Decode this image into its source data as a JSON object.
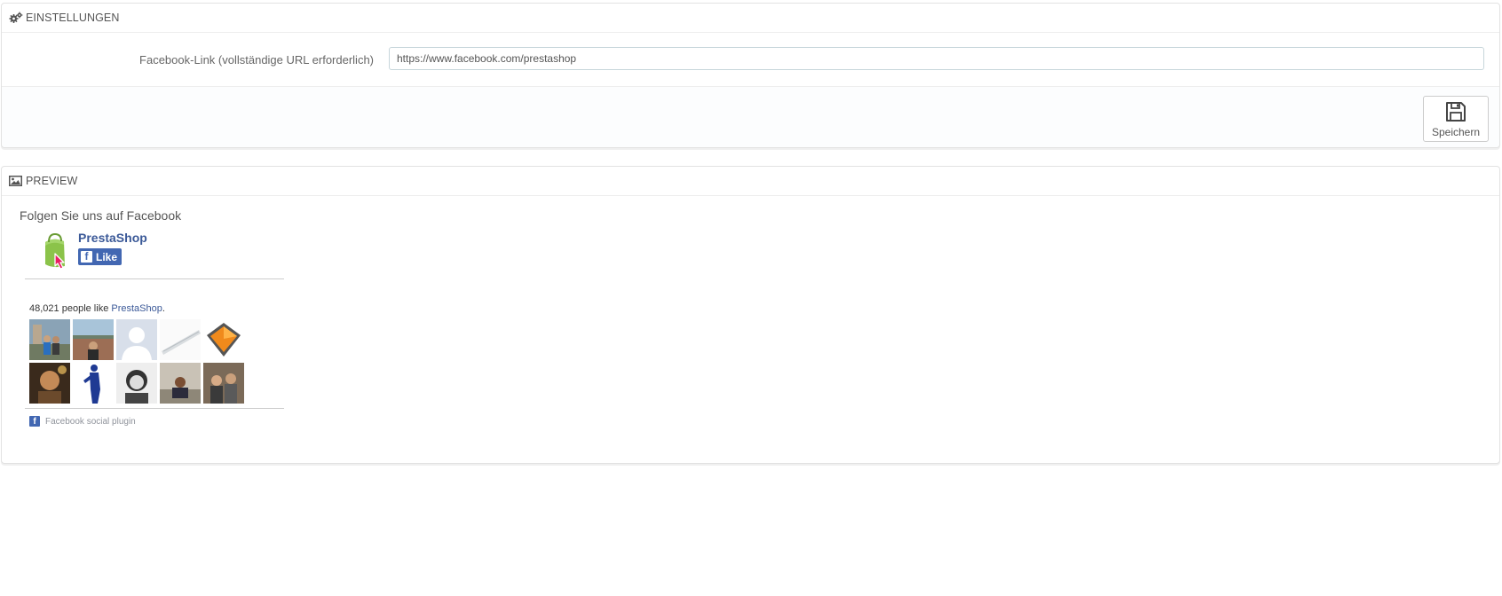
{
  "settings": {
    "heading": "EINSTELLUNGEN",
    "heading_icon": "cogs-icon",
    "field_label": "Facebook-Link (vollständige URL erforderlich)",
    "field_value": "https://www.facebook.com/prestashop",
    "save_label": "Speichern",
    "save_icon": "floppy-disk-icon"
  },
  "preview": {
    "heading": "PREVIEW",
    "heading_icon": "picture-icon",
    "title": "Folgen Sie uns auf Facebook",
    "widget": {
      "page_name": "PrestaShop",
      "like_label": "Like",
      "likes_count": "48,021",
      "likes_text": "people like",
      "likes_page_link": "PrestaShop",
      "likes_suffix": ".",
      "footer": "Facebook social plugin",
      "brand_color": "#4267b2",
      "faces": [
        "profile-photo-1",
        "profile-photo-2",
        "profile-photo-default",
        "profile-photo-4",
        "profile-photo-5",
        "profile-photo-6",
        "profile-photo-7",
        "profile-photo-8",
        "profile-photo-9",
        "profile-photo-10"
      ]
    }
  }
}
